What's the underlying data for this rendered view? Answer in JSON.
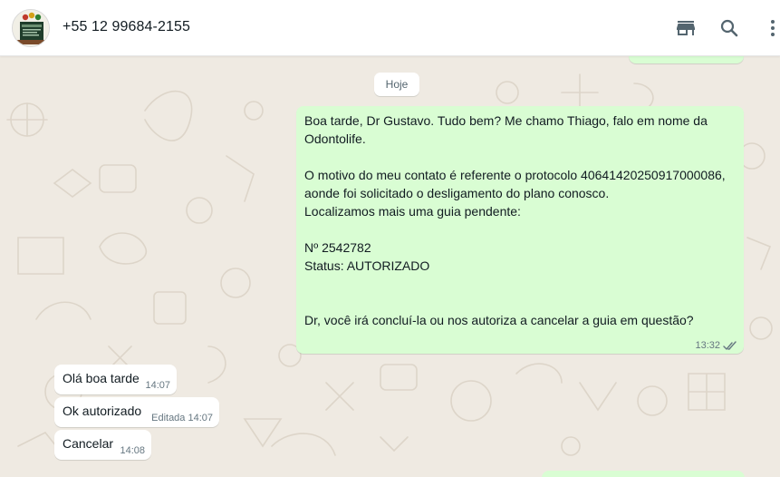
{
  "header": {
    "contact_name": "+55 12 99684-2155",
    "icons": [
      "catalog-store-icon",
      "search-icon",
      "more-options-icon"
    ]
  },
  "chat": {
    "date_chip": "Hoje",
    "outgoing_message": {
      "lines": [
        "Boa tarde, Dr Gustavo. Tudo bem? Me chamo Thiago, falo em nome da",
        "Odontolife.",
        "",
        "O motivo do meu contato é referente o protocolo 40641420250917000086,",
        "aonde foi solicitado o desligamento do plano conosco.",
        "Localizamos mais uma guia pendente:",
        "",
        "Nº 2542782",
        "Status: AUTORIZADO",
        "",
        "",
        "Dr, você irá concluí-la ou nos autoriza a cancelar a guia em questão?"
      ],
      "time": "13:32",
      "status_icon": "double-check-icon"
    },
    "incoming_messages": [
      {
        "text": "Olá boa tarde",
        "meta": "14:07"
      },
      {
        "text": "Ok autorizado",
        "meta": "Editada 14:07"
      },
      {
        "text": "Cancelar",
        "meta": "14:08"
      }
    ]
  },
  "colors": {
    "wallpaper": "#efeae2",
    "outgoing_bubble": "#d9fdd3",
    "incoming_bubble": "#ffffff",
    "read_tick": "#667781"
  }
}
